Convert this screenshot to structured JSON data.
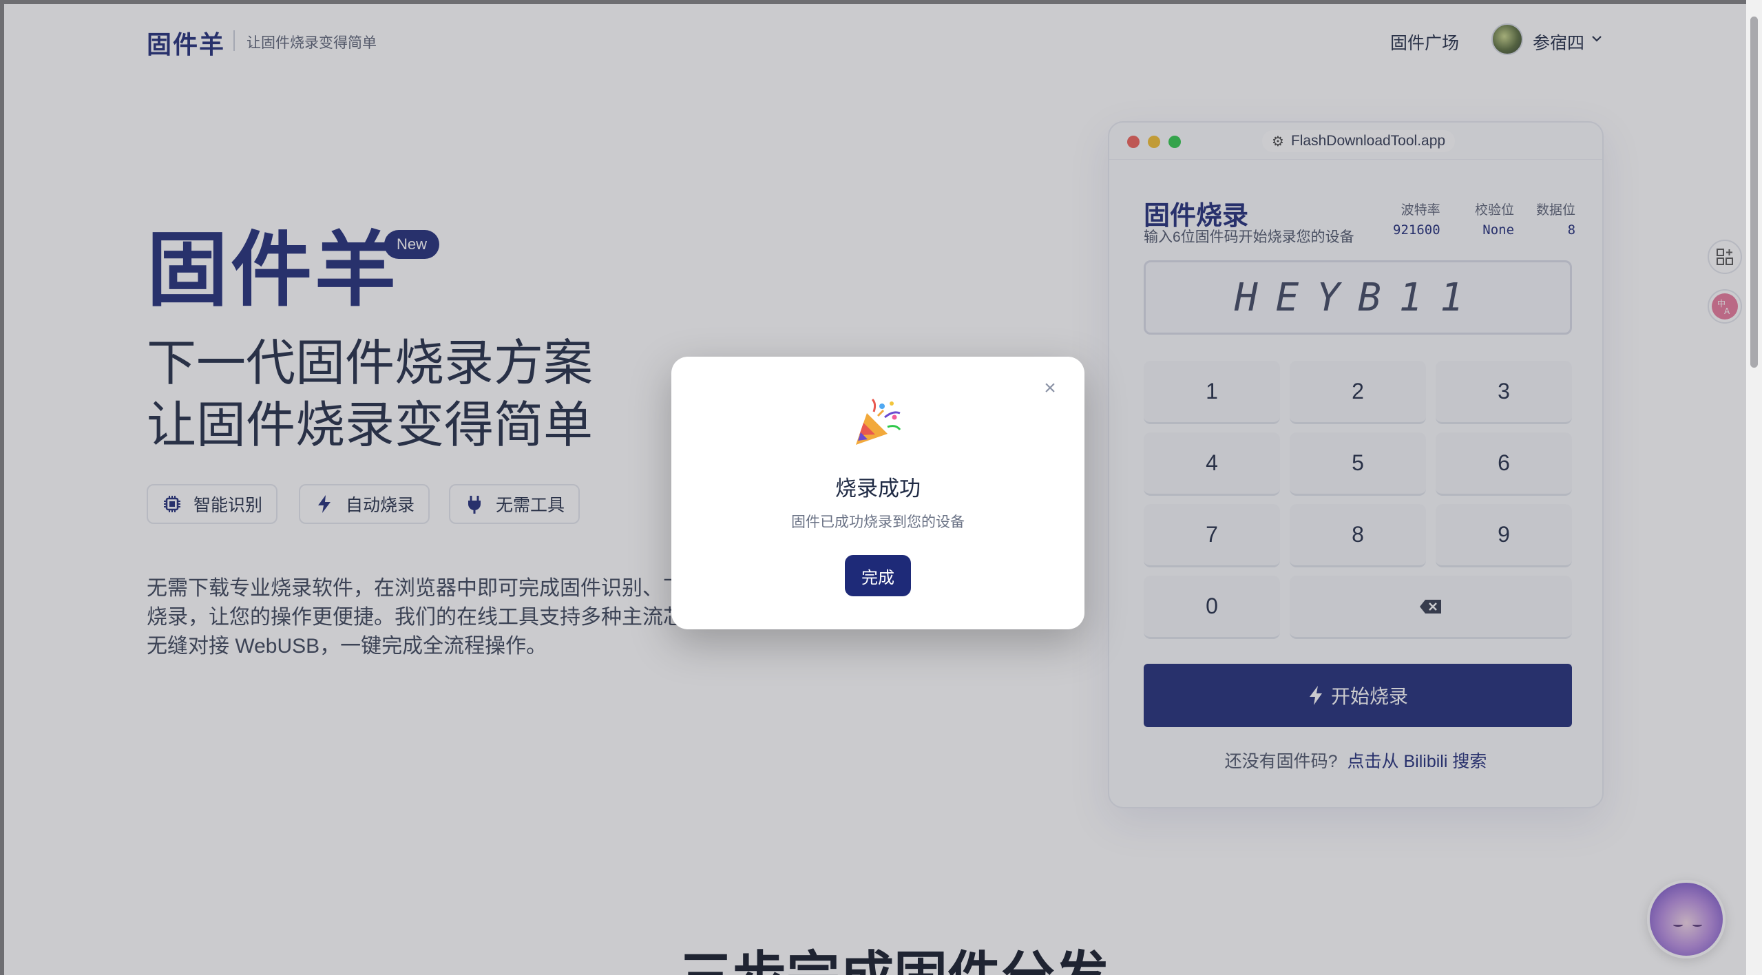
{
  "header": {
    "logo": "固件羊",
    "tagline": "让固件烧录变得简单",
    "nav_plaza": "固件广场",
    "username": "参宿四"
  },
  "hero": {
    "title": "固件羊",
    "badge": "New",
    "subtitle_line1": "下一代固件烧录方案",
    "subtitle_line2": "让固件烧录变得简单",
    "chips": [
      {
        "label": "智能识别",
        "icon": "chip-icon"
      },
      {
        "label": "自动烧录",
        "icon": "bolt-icon"
      },
      {
        "label": "无需工具",
        "icon": "plug-icon"
      }
    ],
    "description_line1": "无需下载专业烧录软件，在浏览器中即可完成固件识别、下",
    "description_line2": "烧录，让您的操作更便捷。我们的在线工具支持多种主流芯",
    "description_line3": "无缝对接 WebUSB，一键完成全流程操作。"
  },
  "section": {
    "title": "三步完成固件分发"
  },
  "device": {
    "window_url": "FlashDownloadTool.app",
    "title": "固件烧录",
    "subtitle": "输入6位固件码开始烧录您的设备",
    "params": [
      {
        "label": "波特率",
        "value": "921600"
      },
      {
        "label": "校验位",
        "value": "None"
      },
      {
        "label": "数据位",
        "value": "8"
      }
    ],
    "display_code": "HEYB11",
    "keys": [
      "1",
      "2",
      "3",
      "4",
      "5",
      "6",
      "7",
      "8",
      "9",
      "0"
    ],
    "start_button": "开始烧录",
    "footer_question": "还没有固件码?",
    "footer_link": "点击从 Bilibili 搜索"
  },
  "modal": {
    "title": "烧录成功",
    "message": "固件已成功烧录到您的设备",
    "button": "完成"
  },
  "colors": {
    "brand": "#1e2a78",
    "overlay": "rgba(70,70,80,0.28)"
  }
}
